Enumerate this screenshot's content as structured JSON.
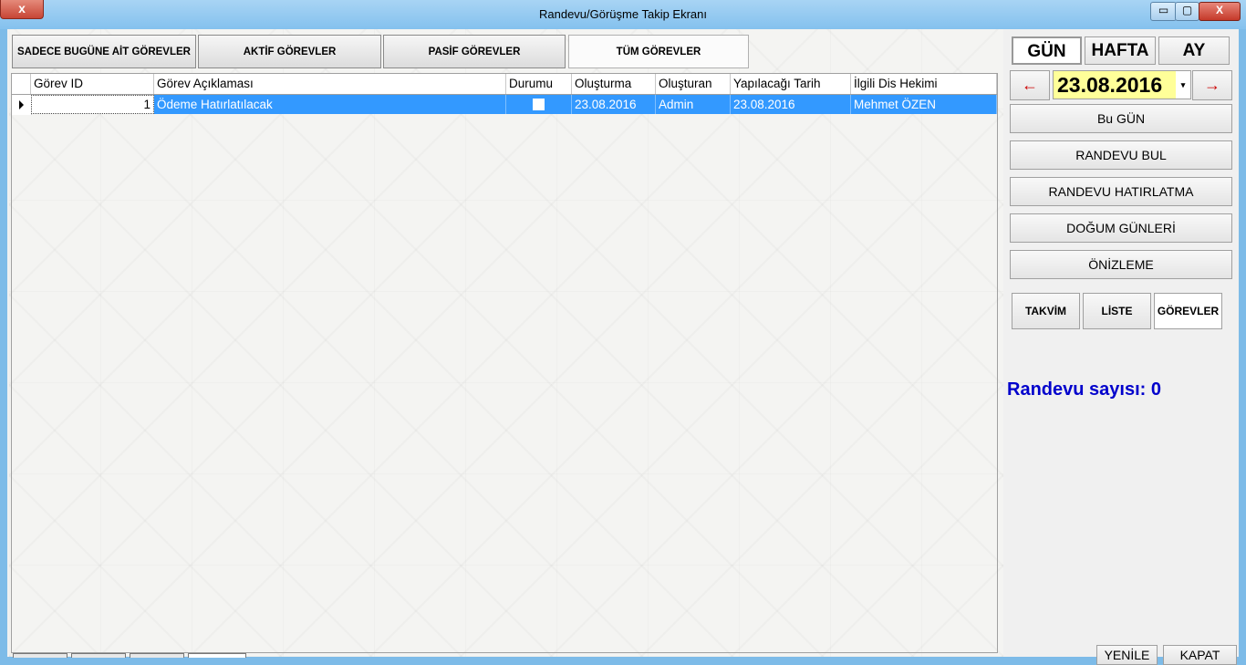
{
  "window": {
    "title": "Randevu/Görüşme Takip Ekranı",
    "left_close_label": "x",
    "minimize_label": "▭",
    "maximize_label": "▢",
    "close_label": "X"
  },
  "tabs": [
    {
      "label": "SADECE BUGÜNE AİT GÖREVLER"
    },
    {
      "label": "AKTİF GÖREVLER"
    },
    {
      "label": "PASİF GÖREVLER"
    },
    {
      "label": "TÜM GÖREVLER"
    }
  ],
  "grid": {
    "columns": [
      "Görev ID",
      "Görev Açıklaması",
      "Durumu",
      "Oluşturma",
      "Oluşturan",
      "Yapılacağı Tarih",
      "İlgili Dis Hekimi"
    ],
    "rows": [
      {
        "id": "1",
        "description": "Ödeme Hatırlatılacak",
        "status_checked": false,
        "created": "23.08.2016",
        "creator": "Admin",
        "due_date": "23.08.2016",
        "dentist": "Mehmet ÖZEN"
      }
    ]
  },
  "right": {
    "views": [
      "GÜN",
      "HAFTA",
      "AY"
    ],
    "prev_label": "←",
    "next_label": "→",
    "date": "23.08.2016",
    "dropdown_icon": "▾",
    "actions": [
      "Bu GÜN",
      "RANDEVU BUL",
      "RANDEVU HATIRLATMA",
      "DOĞUM GÜNLERİ",
      "ÖNİZLEME"
    ],
    "modes": [
      "TAKVİM",
      "LİSTE",
      "GÖREVLER"
    ],
    "count_text": "Randevu sayısı: 0",
    "refresh_label": "YENİLE",
    "close_label": "KAPAT"
  },
  "colors": {
    "selection": "#3399ff",
    "date_bg": "#ffff99",
    "count_text": "#0000cc",
    "arrow": "#cc0000"
  }
}
